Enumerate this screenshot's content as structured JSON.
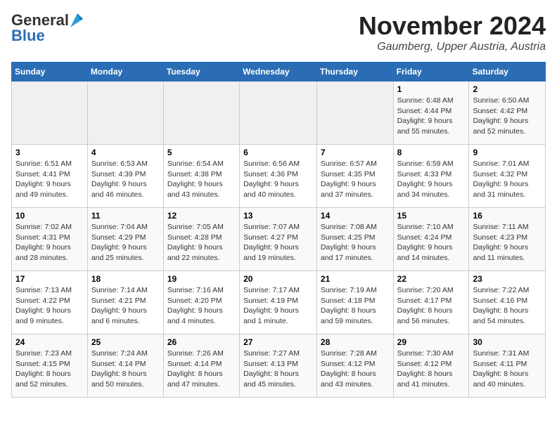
{
  "logo": {
    "general": "General",
    "blue": "Blue"
  },
  "title": {
    "month": "November 2024",
    "location": "Gaumberg, Upper Austria, Austria"
  },
  "headers": [
    "Sunday",
    "Monday",
    "Tuesday",
    "Wednesday",
    "Thursday",
    "Friday",
    "Saturday"
  ],
  "weeks": [
    [
      {
        "day": "",
        "info": ""
      },
      {
        "day": "",
        "info": ""
      },
      {
        "day": "",
        "info": ""
      },
      {
        "day": "",
        "info": ""
      },
      {
        "day": "",
        "info": ""
      },
      {
        "day": "1",
        "info": "Sunrise: 6:48 AM\nSunset: 4:44 PM\nDaylight: 9 hours and 55 minutes."
      },
      {
        "day": "2",
        "info": "Sunrise: 6:50 AM\nSunset: 4:42 PM\nDaylight: 9 hours and 52 minutes."
      }
    ],
    [
      {
        "day": "3",
        "info": "Sunrise: 6:51 AM\nSunset: 4:41 PM\nDaylight: 9 hours and 49 minutes."
      },
      {
        "day": "4",
        "info": "Sunrise: 6:53 AM\nSunset: 4:39 PM\nDaylight: 9 hours and 46 minutes."
      },
      {
        "day": "5",
        "info": "Sunrise: 6:54 AM\nSunset: 4:38 PM\nDaylight: 9 hours and 43 minutes."
      },
      {
        "day": "6",
        "info": "Sunrise: 6:56 AM\nSunset: 4:36 PM\nDaylight: 9 hours and 40 minutes."
      },
      {
        "day": "7",
        "info": "Sunrise: 6:57 AM\nSunset: 4:35 PM\nDaylight: 9 hours and 37 minutes."
      },
      {
        "day": "8",
        "info": "Sunrise: 6:59 AM\nSunset: 4:33 PM\nDaylight: 9 hours and 34 minutes."
      },
      {
        "day": "9",
        "info": "Sunrise: 7:01 AM\nSunset: 4:32 PM\nDaylight: 9 hours and 31 minutes."
      }
    ],
    [
      {
        "day": "10",
        "info": "Sunrise: 7:02 AM\nSunset: 4:31 PM\nDaylight: 9 hours and 28 minutes."
      },
      {
        "day": "11",
        "info": "Sunrise: 7:04 AM\nSunset: 4:29 PM\nDaylight: 9 hours and 25 minutes."
      },
      {
        "day": "12",
        "info": "Sunrise: 7:05 AM\nSunset: 4:28 PM\nDaylight: 9 hours and 22 minutes."
      },
      {
        "day": "13",
        "info": "Sunrise: 7:07 AM\nSunset: 4:27 PM\nDaylight: 9 hours and 19 minutes."
      },
      {
        "day": "14",
        "info": "Sunrise: 7:08 AM\nSunset: 4:25 PM\nDaylight: 9 hours and 17 minutes."
      },
      {
        "day": "15",
        "info": "Sunrise: 7:10 AM\nSunset: 4:24 PM\nDaylight: 9 hours and 14 minutes."
      },
      {
        "day": "16",
        "info": "Sunrise: 7:11 AM\nSunset: 4:23 PM\nDaylight: 9 hours and 11 minutes."
      }
    ],
    [
      {
        "day": "17",
        "info": "Sunrise: 7:13 AM\nSunset: 4:22 PM\nDaylight: 9 hours and 9 minutes."
      },
      {
        "day": "18",
        "info": "Sunrise: 7:14 AM\nSunset: 4:21 PM\nDaylight: 9 hours and 6 minutes."
      },
      {
        "day": "19",
        "info": "Sunrise: 7:16 AM\nSunset: 4:20 PM\nDaylight: 9 hours and 4 minutes."
      },
      {
        "day": "20",
        "info": "Sunrise: 7:17 AM\nSunset: 4:19 PM\nDaylight: 9 hours and 1 minute."
      },
      {
        "day": "21",
        "info": "Sunrise: 7:19 AM\nSunset: 4:18 PM\nDaylight: 8 hours and 59 minutes."
      },
      {
        "day": "22",
        "info": "Sunrise: 7:20 AM\nSunset: 4:17 PM\nDaylight: 8 hours and 56 minutes."
      },
      {
        "day": "23",
        "info": "Sunrise: 7:22 AM\nSunset: 4:16 PM\nDaylight: 8 hours and 54 minutes."
      }
    ],
    [
      {
        "day": "24",
        "info": "Sunrise: 7:23 AM\nSunset: 4:15 PM\nDaylight: 8 hours and 52 minutes."
      },
      {
        "day": "25",
        "info": "Sunrise: 7:24 AM\nSunset: 4:14 PM\nDaylight: 8 hours and 50 minutes."
      },
      {
        "day": "26",
        "info": "Sunrise: 7:26 AM\nSunset: 4:14 PM\nDaylight: 8 hours and 47 minutes."
      },
      {
        "day": "27",
        "info": "Sunrise: 7:27 AM\nSunset: 4:13 PM\nDaylight: 8 hours and 45 minutes."
      },
      {
        "day": "28",
        "info": "Sunrise: 7:28 AM\nSunset: 4:12 PM\nDaylight: 8 hours and 43 minutes."
      },
      {
        "day": "29",
        "info": "Sunrise: 7:30 AM\nSunset: 4:12 PM\nDaylight: 8 hours and 41 minutes."
      },
      {
        "day": "30",
        "info": "Sunrise: 7:31 AM\nSunset: 4:11 PM\nDaylight: 8 hours and 40 minutes."
      }
    ]
  ]
}
